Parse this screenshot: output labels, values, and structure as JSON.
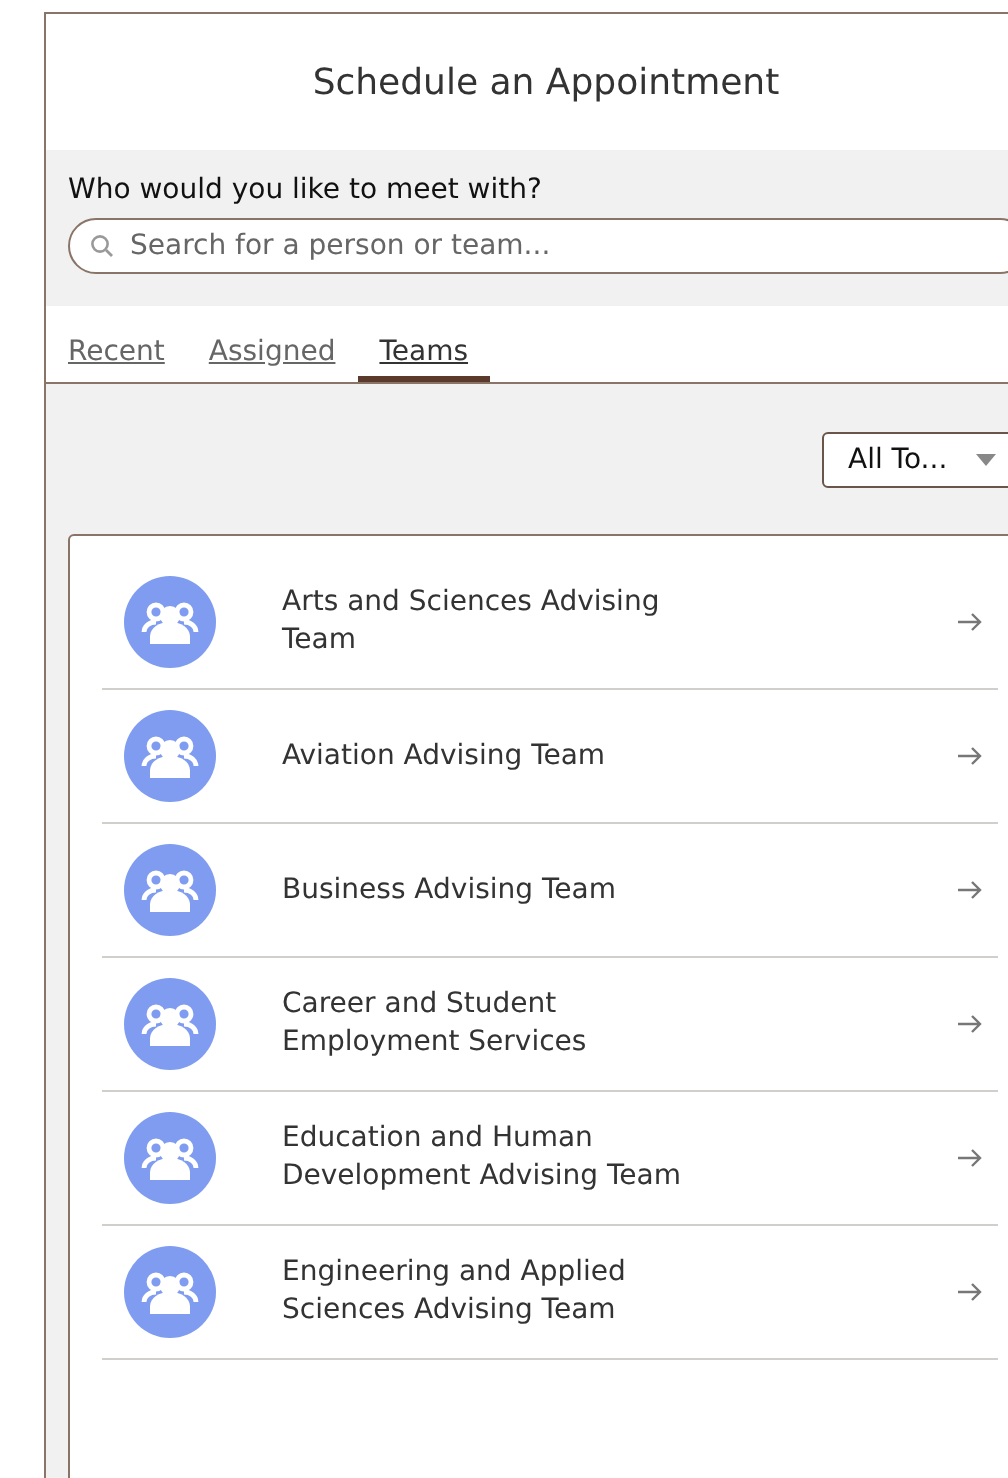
{
  "title": "Schedule an Appointment",
  "search": {
    "label": "Who would you like to meet with?",
    "placeholder": "Search for a person or team..."
  },
  "tabs": [
    {
      "label": "Recent",
      "selected": false
    },
    {
      "label": "Assigned",
      "selected": false
    },
    {
      "label": "Teams",
      "selected": true
    }
  ],
  "filter": {
    "value": "All To..."
  },
  "teams": [
    {
      "name_lines": [
        "Arts and Sciences Advising",
        "Team"
      ]
    },
    {
      "name_lines": [
        "Aviation Advising Team"
      ]
    },
    {
      "name_lines": [
        "Business Advising Team"
      ]
    },
    {
      "name_lines": [
        "Career and Student",
        "Employment Services"
      ]
    },
    {
      "name_lines": [
        "Education and Human",
        "Development Advising Team"
      ]
    },
    {
      "name_lines": [
        "Engineering and Applied",
        "Sciences Advising Team"
      ]
    }
  ]
}
